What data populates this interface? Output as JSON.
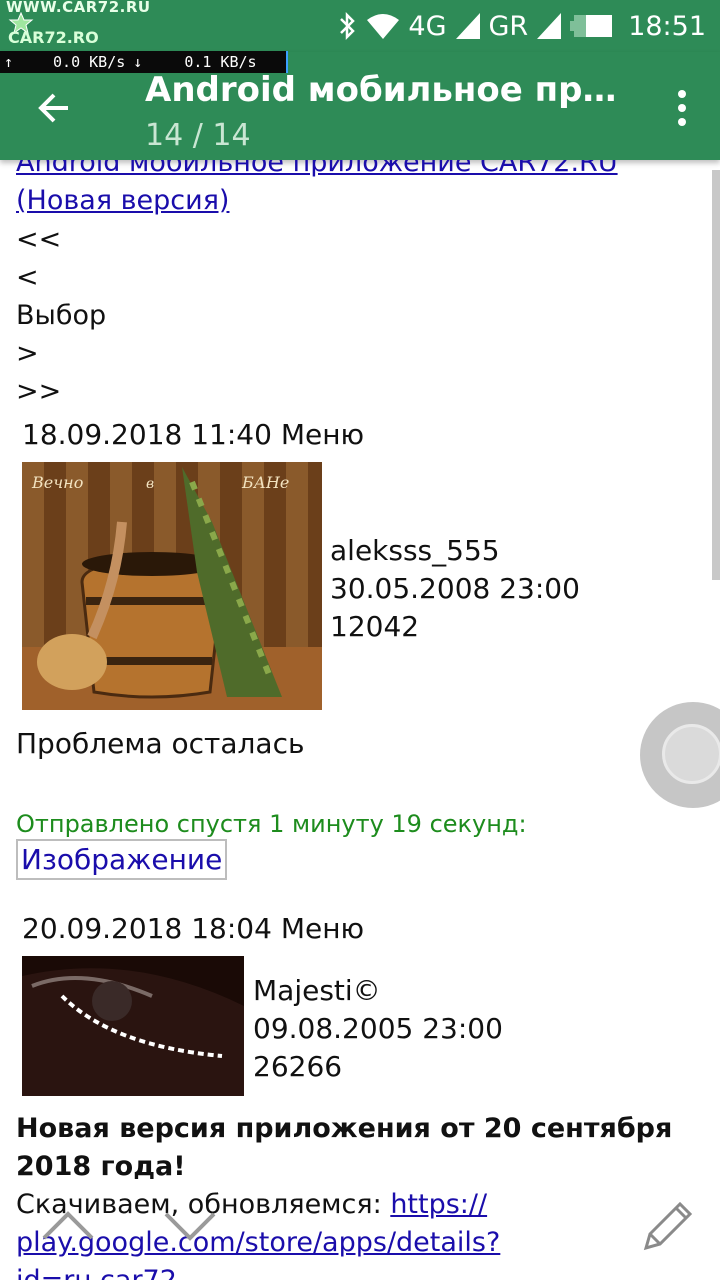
{
  "status_bar": {
    "logo_url": "WWW.CAR72.RU",
    "logo_brand": "CAR72.RO",
    "network": "4G",
    "roaming": "GR",
    "time": "18:51"
  },
  "net_speed": {
    "up": "0.0 KB/s",
    "down": "0.1 KB/s"
  },
  "app_bar": {
    "title": "Android мобильное при...",
    "subtitle": "14 / 14"
  },
  "topic": {
    "link_line1": "Android мобильное приложение CAR72.RU",
    "link_line2": "(Новая версия)"
  },
  "pager": {
    "first": "<<",
    "prev": "<",
    "choose": "Выбор",
    "next": ">",
    "last": ">>"
  },
  "posts": [
    {
      "date": "18.09.2018 11:40",
      "menu": "Меню",
      "avatar_caption_left": "Вечно",
      "avatar_caption_mid": "в",
      "avatar_caption_right": "БАНе",
      "author": "aleksss_555",
      "registered": "30.05.2008 23:00",
      "count": "12042",
      "body": "Проблема осталась",
      "sent_after": "Отправлено спустя 1 минуту 19 секунд:",
      "image_link": "Изображение"
    },
    {
      "date": "20.09.2018 18:04",
      "menu": "Меню",
      "author": "Majesti©",
      "registered": "09.08.2005 23:00",
      "count": "26266",
      "headline_line1": "Новая версия приложения от 20 сентября",
      "headline_line2": "2018 года!",
      "download_prefix": "Скачиваем, обновляемся: ",
      "download_link_line1": "https://",
      "download_link_line2": "play.google.com/store/apps/details?",
      "download_link_line3": "id=ru.car72"
    }
  ],
  "colors": {
    "bar": "#2e8b57",
    "link": "#1a0dab",
    "sent_after": "#1d8c1d"
  }
}
